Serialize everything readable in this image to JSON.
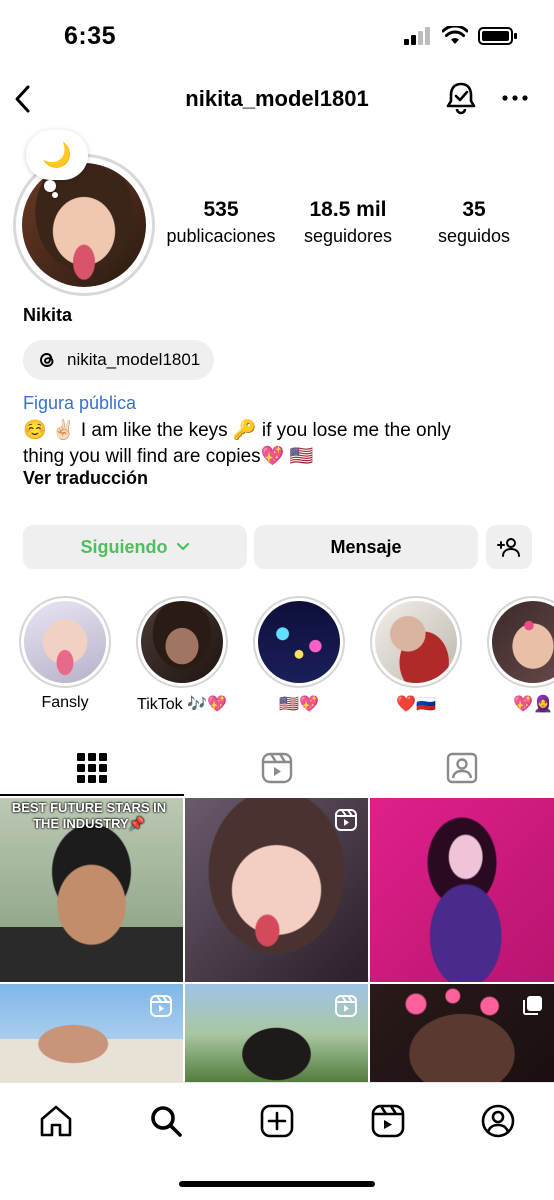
{
  "status_bar": {
    "time": "6:35"
  },
  "header": {
    "username": "nikita_model1801"
  },
  "profile": {
    "note_emoji": "🌙",
    "stats": [
      {
        "value": "535",
        "label": "publicaciones"
      },
      {
        "value": "18.5 mil",
        "label": "seguidores"
      },
      {
        "value": "35",
        "label": "seguidos"
      }
    ],
    "display_name": "Nikita",
    "threads_handle": "nikita_model1801",
    "category": "Figura pública",
    "bio_line1": "☺️ ✌🏻 I am like the keys 🔑 if you lose me the only",
    "bio_line2": "thing you will find are copies💖  🇺🇸",
    "translate_label": "Ver traducción"
  },
  "actions": {
    "following_label": "Siguiendo",
    "message_label": "Mensaje"
  },
  "highlights": [
    {
      "label": "Fansly"
    },
    {
      "label": "TikTok 🎶💖"
    },
    {
      "label": "🇺🇸💖"
    },
    {
      "label": "❤️🇷🇺"
    },
    {
      "label": "💖🧕"
    }
  ],
  "posts": [
    {
      "caption": "BEST FUTURE STARS IN THE INDUSTRY📌",
      "type": "pinned"
    },
    {
      "caption": "",
      "type": "reel"
    },
    {
      "caption": "",
      "type": "photo"
    },
    {
      "caption": "",
      "type": "reel"
    },
    {
      "caption": "",
      "type": "reel"
    },
    {
      "caption": "",
      "type": "carousel"
    }
  ],
  "colors": {
    "link_blue": "#3b6fd1",
    "following_green": "#4dbf5e",
    "button_bg": "#efefef"
  }
}
